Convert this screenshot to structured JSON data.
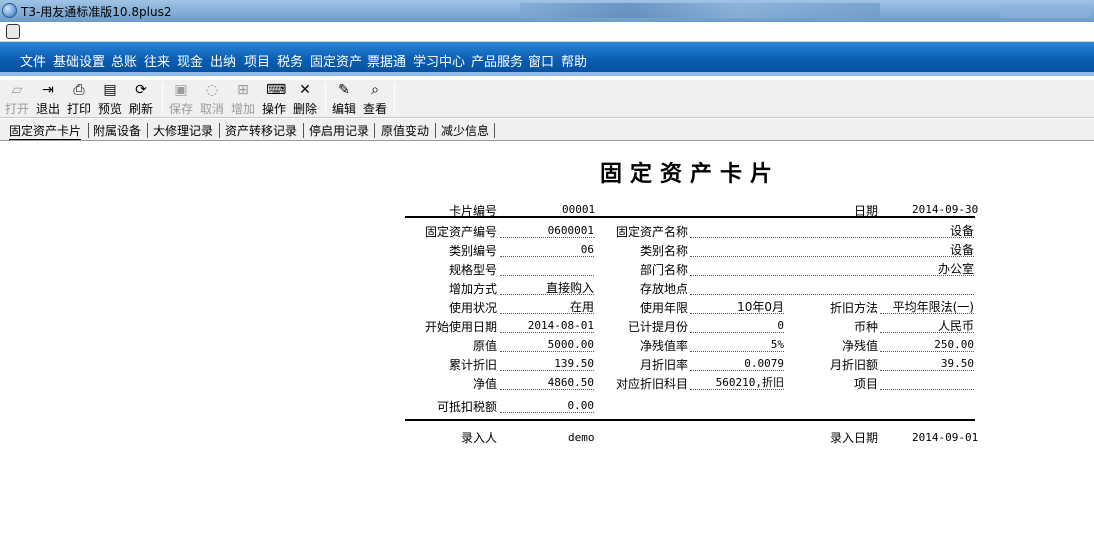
{
  "window": {
    "title": "T3-用友通标准版10.8plus2"
  },
  "menu": [
    "文件",
    "基础设置",
    "总账",
    "往来",
    "现金",
    "出纳",
    "项目",
    "税务",
    "固定资产",
    "票据通",
    "学习中心",
    "产品服务",
    "窗口",
    "帮助"
  ],
  "toolbar": {
    "open": "打开",
    "exit": "退出",
    "print": "打印",
    "preview": "预览",
    "refresh": "刷新",
    "save": "保存",
    "cancel": "取消",
    "add": "增加",
    "operate": "操作",
    "delete": "删除",
    "edit": "编辑",
    "view": "查看"
  },
  "tabs": [
    "固定资产卡片",
    "附属设备",
    "大修理记录",
    "资产转移记录",
    "停启用记录",
    "原值变动",
    "减少信息"
  ],
  "card": {
    "title": "固定资产卡片",
    "card_no_label": "卡片编号",
    "card_no": "00001",
    "date_label": "日期",
    "date": "2014-09-30",
    "asset_no_label": "固定资产编号",
    "asset_no": "0600001",
    "asset_name_label": "固定资产名称",
    "asset_name": "设备",
    "cat_no_label": "类别编号",
    "cat_no": "06",
    "cat_name_label": "类别名称",
    "cat_name": "设备",
    "spec_label": "规格型号",
    "spec": "",
    "dept_label": "部门名称",
    "dept": "办公室",
    "add_method_label": "增加方式",
    "add_method": "直接购入",
    "location_label": "存放地点",
    "location": "",
    "status_label": "使用状况",
    "status": "在用",
    "life_label": "使用年限",
    "life": "10年0月",
    "dep_method_label": "折旧方法",
    "dep_method": "平均年限法(一)",
    "start_date_label": "开始使用日期",
    "start_date": "2014-08-01",
    "months_label": "已计提月份",
    "months": "0",
    "currency_label": "币种",
    "currency": "人民币",
    "orig_label": "原值",
    "orig": "5000.00",
    "salvage_rate_label": "净残值率",
    "salvage_rate": "5%",
    "salvage_label": "净残值",
    "salvage": "250.00",
    "acc_dep_label": "累计折旧",
    "acc_dep": "139.50",
    "monthly_rate_label": "月折旧率",
    "monthly_rate": "0.0079",
    "monthly_amt_label": "月折旧额",
    "monthly_amt": "39.50",
    "net_label": "净值",
    "net": "4860.50",
    "dep_subject_label": "对应折旧科目",
    "dep_subject": "560210,折旧",
    "item_label": "项目",
    "item": "",
    "tax_label": "可抵扣税额",
    "tax": "0.00",
    "entered_by_label": "录入人",
    "entered_by": "demo",
    "entry_date_label": "录入日期",
    "entry_date": "2014-09-01"
  }
}
